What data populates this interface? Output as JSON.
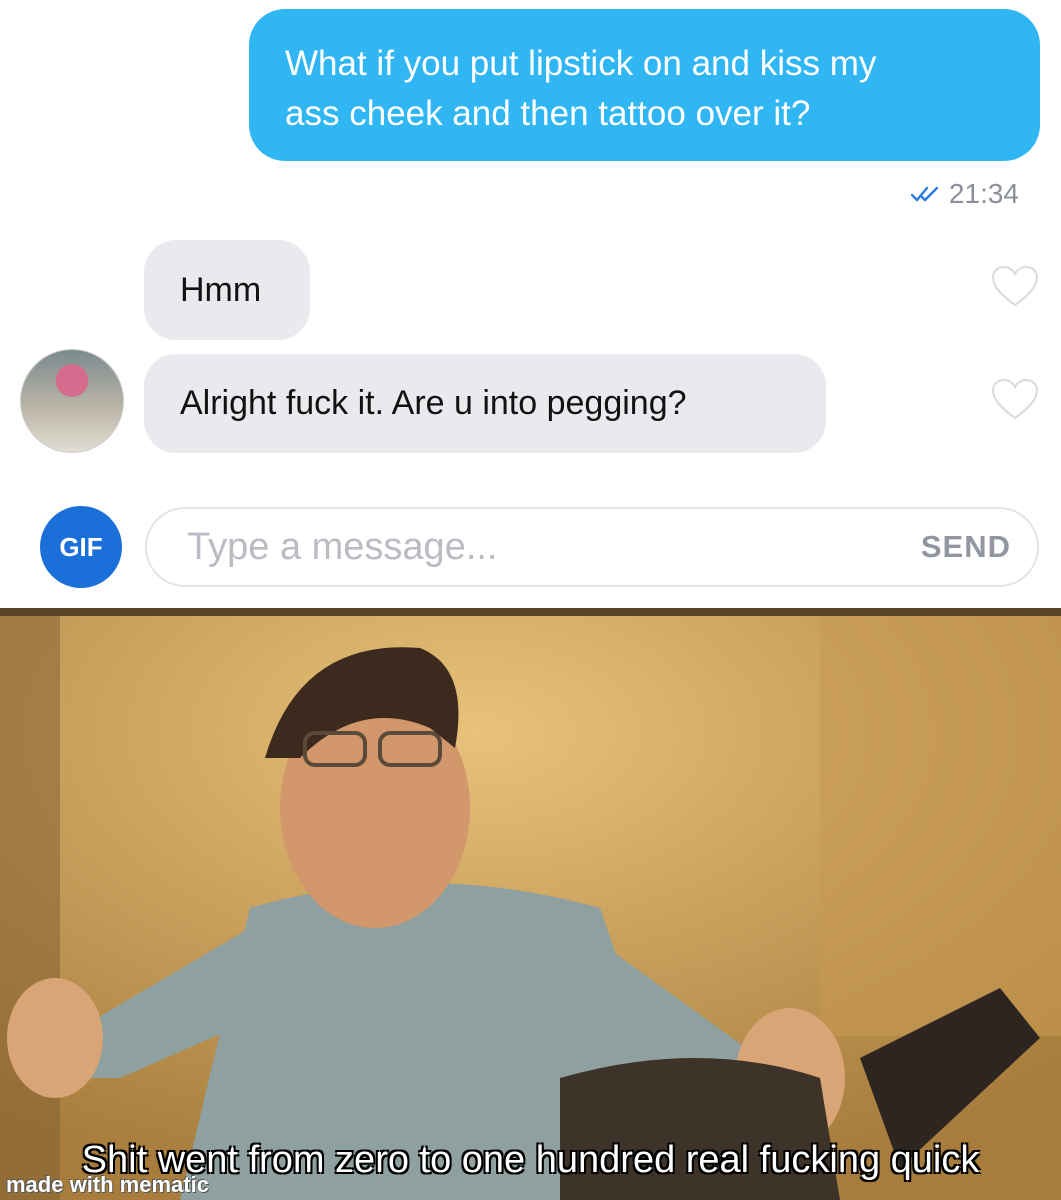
{
  "conversation": {
    "outgoing_message": "What if you put lipstick on and kiss my ass cheek and then tattoo over it?",
    "outgoing_line_1": "What if you put lipstick on and kiss my",
    "outgoing_line_2": "ass cheek and then tattoo over it?",
    "outgoing_time": "21:34",
    "incoming": [
      {
        "text": "Hmm"
      },
      {
        "text": "Alright fuck it. Are u into pegging?"
      }
    ]
  },
  "composer": {
    "gif_label": "GIF",
    "placeholder": "Type a message...",
    "send_label": "SEND"
  },
  "meme": {
    "caption": "Shit went from zero to one hundred real fucking quick",
    "watermark": "made with mematic"
  },
  "colors": {
    "outgoing_bubble": "#2fb6f3",
    "incoming_bubble": "#e9eaee",
    "gif_button": "#1b6fd8",
    "read_check": "#2a7de1"
  },
  "icons": [
    "double-check-icon",
    "heart-outline-icon",
    "avatar"
  ]
}
